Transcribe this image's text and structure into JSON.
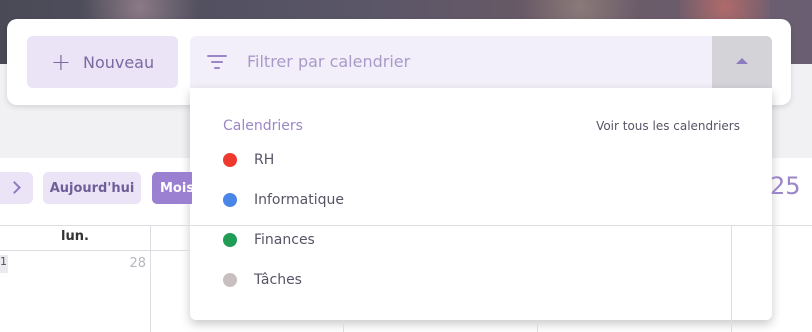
{
  "toolbar": {
    "new_button_icon": "plus-icon",
    "new_button_label": "Nouveau",
    "filter_icon": "filter-icon",
    "filter_placeholder": "Filtrer par calendrier",
    "filter_toggle_icon": "caret-up-icon"
  },
  "dropdown": {
    "title": "Calendriers",
    "see_all_link": "Voir tous les calendriers",
    "items": [
      {
        "label": "RH",
        "color": "#f0392e"
      },
      {
        "label": "Informatique",
        "color": "#4a86e8"
      },
      {
        "label": "Finances",
        "color": "#1f9d55"
      },
      {
        "label": "Tâches",
        "color": "#c9bfc0"
      }
    ]
  },
  "calendar": {
    "next_icon": "chevron-right-icon",
    "today_label": "Aujourd'hui",
    "month_label": "Mois",
    "year_partial": "25",
    "day_headers": [
      "lun."
    ],
    "week_number": "1",
    "first_day_number": "28"
  }
}
